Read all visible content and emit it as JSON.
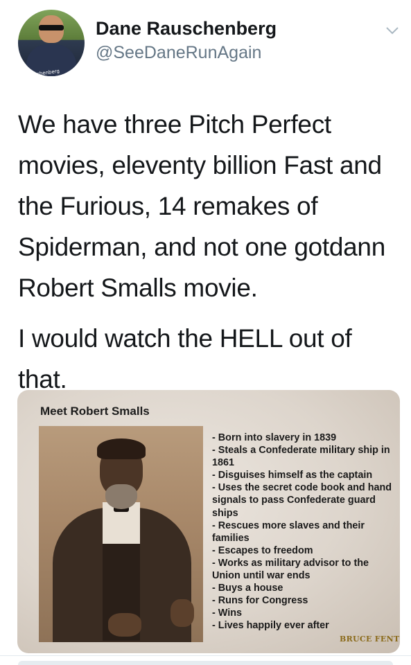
{
  "tweet": {
    "author": {
      "display_name": "Dane Rauschenberg",
      "handle": "@SeeDaneRunAgain",
      "avatar_shirt_text": "Rauschenberg"
    },
    "menu_icon": "chevron-down-icon",
    "paragraphs": [
      "We have three Pitch Perfect movies, eleventy billion Fast and the Furious, 14 remakes of Spiderman, and not one gotdann Robert Smalls  movie.",
      "I would watch the HELL out of that."
    ]
  },
  "image_card": {
    "title": "Meet Robert Smalls",
    "facts": [
      "- Born into slavery in 1839",
      "- Steals a Confederate military ship in 1861",
      "- Disguises himself as the captain",
      "- Uses the secret code book and hand signals to pass Confederate guard ships",
      "- Rescues more slaves and their families",
      "- Escapes to freedom",
      "- Works as military advisor to the Union until war ends",
      "- Buys a house",
      "- Runs for Congress",
      "- Wins",
      "- Lives happily ever after"
    ],
    "signature": "BRUCE FENTON"
  },
  "colors": {
    "text": "#14171a",
    "secondary": "#657786",
    "divider": "#e1e8ed"
  }
}
